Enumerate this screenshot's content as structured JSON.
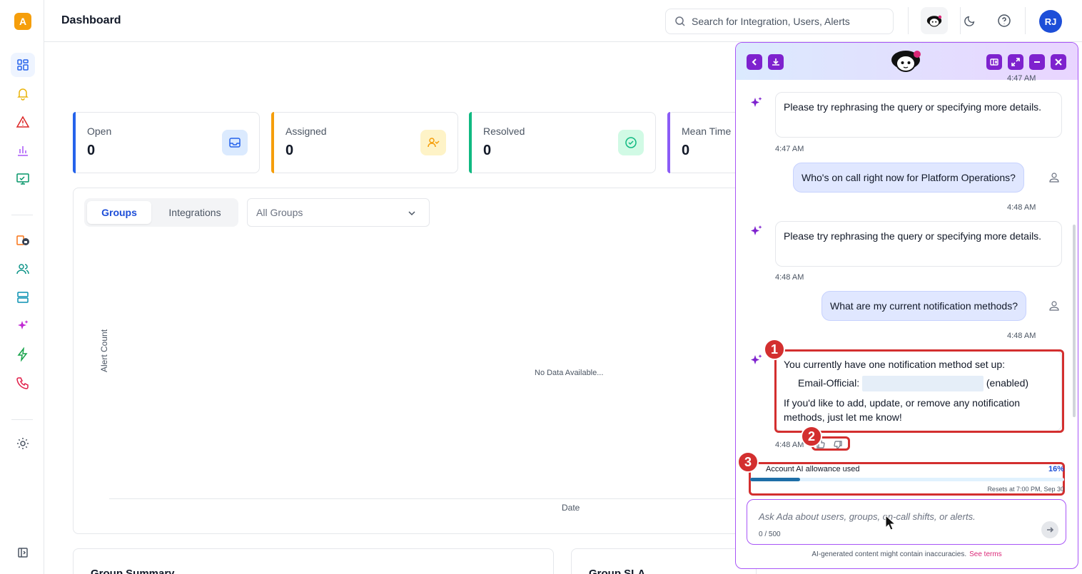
{
  "app": {
    "logo_letter": "A",
    "accent": "#f59e0b"
  },
  "header": {
    "title": "Dashboard",
    "search_placeholder": "Search for Integration, Users, Alerts",
    "user_initials": "RJ"
  },
  "sidebar": {
    "items": [
      {
        "icon": "dashboard-icon",
        "active": true
      },
      {
        "icon": "bell-icon"
      },
      {
        "icon": "alert-triangle-icon"
      },
      {
        "icon": "bar-chart-icon"
      },
      {
        "icon": "monitor-icon"
      },
      {
        "icon": "schedule-lock-icon"
      },
      {
        "icon": "users-icon"
      },
      {
        "icon": "server-icon"
      },
      {
        "icon": "sparkles-icon"
      },
      {
        "icon": "lightning-icon"
      },
      {
        "icon": "phone-icon"
      },
      {
        "icon": "settings-icon"
      },
      {
        "icon": "collapse-sidebar-icon"
      }
    ]
  },
  "stats": [
    {
      "label": "Open",
      "value": "0",
      "color": "#2563eb"
    },
    {
      "label": "Assigned",
      "value": "0",
      "color": "#f59e0b"
    },
    {
      "label": "Resolved",
      "value": "0",
      "color": "#10b981"
    },
    {
      "label": "Mean Time",
      "value": "0",
      "color": "#8b5cf6"
    }
  ],
  "chart_panel": {
    "tabs": [
      "Groups",
      "Integrations"
    ],
    "active_tab": "Groups",
    "group_select": "All Groups",
    "empty_text": "No Data Available...",
    "ylabel": "Alert Count",
    "xlabel": "Date"
  },
  "bottom_cards": [
    "Group Summary",
    "Group SLA"
  ],
  "chat": {
    "top_timestamp": "4:47 AM",
    "messages": [
      {
        "role": "ai",
        "text": "Please try rephrasing the query or specifying more details.",
        "time": "4:47 AM"
      },
      {
        "role": "user",
        "text": "Who's on call right now for Platform Operations?",
        "time": "4:48 AM"
      },
      {
        "role": "ai",
        "text": "Please try rephrasing the query or specifying more details.",
        "time": "4:48 AM"
      },
      {
        "role": "user",
        "text": "What are my current notification methods?",
        "time": "4:48 AM"
      },
      {
        "role": "ai",
        "line1": "You currently have one notification method set up:",
        "method_label": "Email-Official:",
        "method_state": "(enabled)",
        "line3": "If you'd like to add, update, or remove any notification methods, just let me know!",
        "time": "4:48 AM"
      }
    ],
    "usage": {
      "label": "Account AI allowance used",
      "percent_text": "16%",
      "percent": 16,
      "resets": "Resets at 7:00 PM, Sep 30"
    },
    "input_placeholder": "Ask Ada about users, groups, on-call shifts, or alerts.",
    "char_count": "0 / 500",
    "disclaimer": "AI-generated content might contain inaccuracies.",
    "terms_link": "See terms"
  },
  "annotations": [
    "1",
    "2",
    "3"
  ]
}
